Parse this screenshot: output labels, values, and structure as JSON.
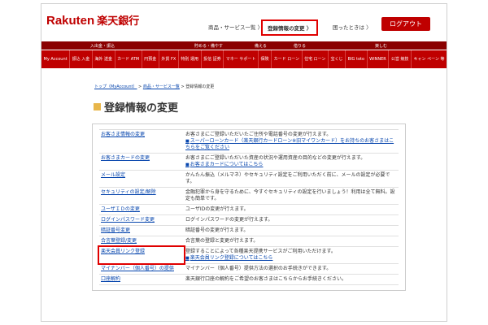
{
  "header": {
    "logo_en": "Rakuten",
    "logo_jp": "楽天銀行",
    "nav": [
      "商品・サービス一覧 〉",
      "登録情報の変更 〉",
      "困ったときは 〉"
    ],
    "logout": "ログアウト"
  },
  "categories": [
    "入出金・振込",
    "貯める・備やす",
    "備える",
    "借りる",
    "楽しむ"
  ],
  "navbar": [
    "My Account",
    "振込 入金",
    "海外 送金",
    "カード ATM",
    "円預金",
    "外貨 FX",
    "特別 運用",
    "投信 証券",
    "マネー サポート",
    "保険",
    "カード ローン",
    "住宅 ローン",
    "宝くじ",
    "BIG toto",
    "WINNER",
    "公営 競技",
    "キャン ペーン 等"
  ],
  "breadcrumb": {
    "top": "トップ（MyAccount）",
    "sep": " > ",
    "list": "商品・サービス一覧",
    "current": "登録情報の変更"
  },
  "page_title": "登録情報の変更",
  "rows": [
    {
      "label": "お客さま情報の変更",
      "desc": "お客さまにご登録いただいたご住所や電話番号の変更が行えます。",
      "link": "スーパーローンカード（楽天銀行カードローン※旧マイワンカード）をお持ちのお客さまはこちらをご覧ください"
    },
    {
      "label": "お客さまカードの変更",
      "desc": "お客さまにご登録いただいた資産の状況や運用資産の目的などの変更が行えます。",
      "link": "お客さまカードについてはこちら"
    },
    {
      "label": "メール設定",
      "desc": "かんたん振込（メルマネ）やセキュリティ設定をご利用いただく前に、メールの設定が必要です。",
      "link": ""
    },
    {
      "label": "セキュリティの設定/解除",
      "desc": "金融犯罪から身を守るために、今すぐセキュリティの設定を行いましょう！利用は全て無料。設定も簡単です。",
      "link": ""
    },
    {
      "label": "ユーザＩＤの変更",
      "desc": "ユーザIDの変更が行えます。",
      "link": ""
    },
    {
      "label": "ログインパスワード変更",
      "desc": "ログインパスワードの変更が行えます。",
      "link": ""
    },
    {
      "label": "暗証番号変更",
      "desc": "暗証番号の変更が行えます。",
      "link": ""
    },
    {
      "label": "合言葉登録/変更",
      "desc": "合言葉の登録と変更が行えます。",
      "link": ""
    },
    {
      "label": "楽天会員リンク登録",
      "desc": "登録することによって各種楽天提携サービスがご利用いただけます。",
      "link": "楽天会員リンク登録についてはこちら"
    },
    {
      "label": "マイナンバー（個人番号）の提供",
      "desc": "マイナンバー（個人番号）提供方法の選択のお手続きができます。",
      "link": ""
    },
    {
      "label": "口座解約",
      "desc": "楽天銀行口座の解約をご希望のお客さまはこちらからお手続きください。",
      "link": ""
    }
  ]
}
